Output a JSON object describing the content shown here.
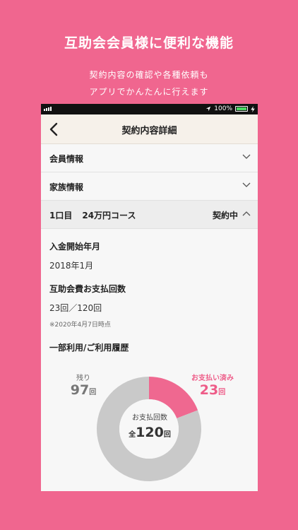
{
  "promo": {
    "title": "互助会会員様に便利な機能",
    "line1": "契約内容の確認や各種依頼も",
    "line2": "アプリでかんたんに行えます"
  },
  "statusbar": {
    "battery_text": "100%"
  },
  "navbar": {
    "title": "契約内容詳細"
  },
  "sections": {
    "member_info": "会員情報",
    "family_info": "家族情報"
  },
  "course": {
    "index": "1口目",
    "name": "24万円コース",
    "status": "契約中"
  },
  "details": {
    "start_label": "入金開始年月",
    "start_value": "2018年1月",
    "payments_label": "互助会費お支払回数",
    "payments_value": "23回／120回",
    "as_of": "※2020年4月7日時点",
    "usage_label": "一部利用/ご利用履歴"
  },
  "chart_data": {
    "type": "pie",
    "categories": [
      "お支払い済み",
      "残り"
    ],
    "values": [
      23,
      97
    ],
    "total": 120,
    "colors": [
      "#ef6890",
      "#c9c9c9"
    ],
    "labels": {
      "paid_title": "お支払い済み",
      "paid_value": "23",
      "remaining_title": "残り",
      "remaining_value": "97",
      "unit": "回",
      "center_title": "お支払回数",
      "center_prefix": "全",
      "center_value": "120"
    }
  }
}
